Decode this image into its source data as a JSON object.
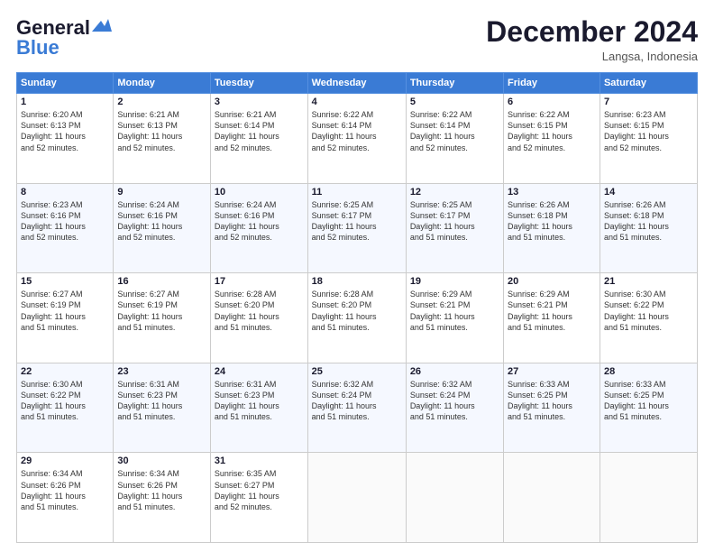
{
  "logo": {
    "line1": "General",
    "line2": "Blue"
  },
  "title": "December 2024",
  "location": "Langsa, Indonesia",
  "header": {
    "days": [
      "Sunday",
      "Monday",
      "Tuesday",
      "Wednesday",
      "Thursday",
      "Friday",
      "Saturday"
    ]
  },
  "weeks": [
    [
      {
        "day": "1",
        "info": "Sunrise: 6:20 AM\nSunset: 6:13 PM\nDaylight: 11 hours\nand 52 minutes."
      },
      {
        "day": "2",
        "info": "Sunrise: 6:21 AM\nSunset: 6:13 PM\nDaylight: 11 hours\nand 52 minutes."
      },
      {
        "day": "3",
        "info": "Sunrise: 6:21 AM\nSunset: 6:14 PM\nDaylight: 11 hours\nand 52 minutes."
      },
      {
        "day": "4",
        "info": "Sunrise: 6:22 AM\nSunset: 6:14 PM\nDaylight: 11 hours\nand 52 minutes."
      },
      {
        "day": "5",
        "info": "Sunrise: 6:22 AM\nSunset: 6:14 PM\nDaylight: 11 hours\nand 52 minutes."
      },
      {
        "day": "6",
        "info": "Sunrise: 6:22 AM\nSunset: 6:15 PM\nDaylight: 11 hours\nand 52 minutes."
      },
      {
        "day": "7",
        "info": "Sunrise: 6:23 AM\nSunset: 6:15 PM\nDaylight: 11 hours\nand 52 minutes."
      }
    ],
    [
      {
        "day": "8",
        "info": "Sunrise: 6:23 AM\nSunset: 6:16 PM\nDaylight: 11 hours\nand 52 minutes."
      },
      {
        "day": "9",
        "info": "Sunrise: 6:24 AM\nSunset: 6:16 PM\nDaylight: 11 hours\nand 52 minutes."
      },
      {
        "day": "10",
        "info": "Sunrise: 6:24 AM\nSunset: 6:16 PM\nDaylight: 11 hours\nand 52 minutes."
      },
      {
        "day": "11",
        "info": "Sunrise: 6:25 AM\nSunset: 6:17 PM\nDaylight: 11 hours\nand 52 minutes."
      },
      {
        "day": "12",
        "info": "Sunrise: 6:25 AM\nSunset: 6:17 PM\nDaylight: 11 hours\nand 51 minutes."
      },
      {
        "day": "13",
        "info": "Sunrise: 6:26 AM\nSunset: 6:18 PM\nDaylight: 11 hours\nand 51 minutes."
      },
      {
        "day": "14",
        "info": "Sunrise: 6:26 AM\nSunset: 6:18 PM\nDaylight: 11 hours\nand 51 minutes."
      }
    ],
    [
      {
        "day": "15",
        "info": "Sunrise: 6:27 AM\nSunset: 6:19 PM\nDaylight: 11 hours\nand 51 minutes."
      },
      {
        "day": "16",
        "info": "Sunrise: 6:27 AM\nSunset: 6:19 PM\nDaylight: 11 hours\nand 51 minutes."
      },
      {
        "day": "17",
        "info": "Sunrise: 6:28 AM\nSunset: 6:20 PM\nDaylight: 11 hours\nand 51 minutes."
      },
      {
        "day": "18",
        "info": "Sunrise: 6:28 AM\nSunset: 6:20 PM\nDaylight: 11 hours\nand 51 minutes."
      },
      {
        "day": "19",
        "info": "Sunrise: 6:29 AM\nSunset: 6:21 PM\nDaylight: 11 hours\nand 51 minutes."
      },
      {
        "day": "20",
        "info": "Sunrise: 6:29 AM\nSunset: 6:21 PM\nDaylight: 11 hours\nand 51 minutes."
      },
      {
        "day": "21",
        "info": "Sunrise: 6:30 AM\nSunset: 6:22 PM\nDaylight: 11 hours\nand 51 minutes."
      }
    ],
    [
      {
        "day": "22",
        "info": "Sunrise: 6:30 AM\nSunset: 6:22 PM\nDaylight: 11 hours\nand 51 minutes."
      },
      {
        "day": "23",
        "info": "Sunrise: 6:31 AM\nSunset: 6:23 PM\nDaylight: 11 hours\nand 51 minutes."
      },
      {
        "day": "24",
        "info": "Sunrise: 6:31 AM\nSunset: 6:23 PM\nDaylight: 11 hours\nand 51 minutes."
      },
      {
        "day": "25",
        "info": "Sunrise: 6:32 AM\nSunset: 6:24 PM\nDaylight: 11 hours\nand 51 minutes."
      },
      {
        "day": "26",
        "info": "Sunrise: 6:32 AM\nSunset: 6:24 PM\nDaylight: 11 hours\nand 51 minutes."
      },
      {
        "day": "27",
        "info": "Sunrise: 6:33 AM\nSunset: 6:25 PM\nDaylight: 11 hours\nand 51 minutes."
      },
      {
        "day": "28",
        "info": "Sunrise: 6:33 AM\nSunset: 6:25 PM\nDaylight: 11 hours\nand 51 minutes."
      }
    ],
    [
      {
        "day": "29",
        "info": "Sunrise: 6:34 AM\nSunset: 6:26 PM\nDaylight: 11 hours\nand 51 minutes."
      },
      {
        "day": "30",
        "info": "Sunrise: 6:34 AM\nSunset: 6:26 PM\nDaylight: 11 hours\nand 51 minutes."
      },
      {
        "day": "31",
        "info": "Sunrise: 6:35 AM\nSunset: 6:27 PM\nDaylight: 11 hours\nand 52 minutes."
      },
      {
        "day": "",
        "info": ""
      },
      {
        "day": "",
        "info": ""
      },
      {
        "day": "",
        "info": ""
      },
      {
        "day": "",
        "info": ""
      }
    ]
  ]
}
